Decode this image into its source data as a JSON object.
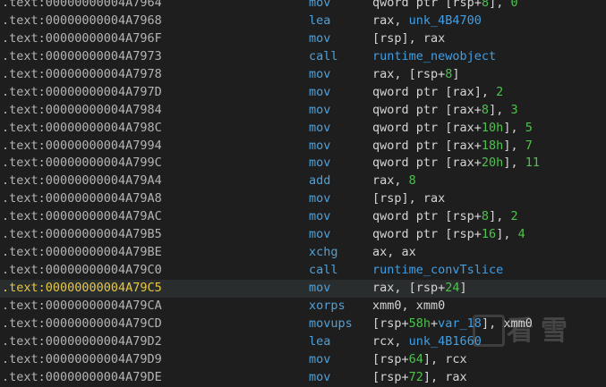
{
  "lines": [
    {
      "addr": ".text:00000000004A7964",
      "mnem": "mov",
      "ops": [
        [
          "qword ptr ",
          "kw"
        ],
        [
          "[",
          "punc"
        ],
        [
          "rsp",
          "reg"
        ],
        [
          "+",
          "punc"
        ],
        [
          "8",
          "num"
        ],
        [
          "], ",
          "punc"
        ],
        [
          "0",
          "num"
        ]
      ]
    },
    {
      "addr": ".text:00000000004A7968",
      "mnem": "lea",
      "ops": [
        [
          "rax, ",
          "reg"
        ],
        [
          "unk_4B4700",
          "sym"
        ]
      ]
    },
    {
      "addr": ".text:00000000004A796F",
      "mnem": "mov",
      "ops": [
        [
          "[rsp], rax",
          "reg"
        ]
      ]
    },
    {
      "addr": ".text:00000000004A7973",
      "mnem": "call",
      "ops": [
        [
          "runtime_newobject",
          "sym"
        ]
      ]
    },
    {
      "addr": ".text:00000000004A7978",
      "mnem": "mov",
      "ops": [
        [
          "rax, [rsp+",
          "reg"
        ],
        [
          "8",
          "num"
        ],
        [
          "]",
          "punc"
        ]
      ]
    },
    {
      "addr": ".text:00000000004A797D",
      "mnem": "mov",
      "ops": [
        [
          "qword ptr [rax], ",
          "reg"
        ],
        [
          "2",
          "num"
        ]
      ]
    },
    {
      "addr": ".text:00000000004A7984",
      "mnem": "mov",
      "ops": [
        [
          "qword ptr [rax+",
          "reg"
        ],
        [
          "8",
          "num"
        ],
        [
          "], ",
          "punc"
        ],
        [
          "3",
          "num"
        ]
      ]
    },
    {
      "addr": ".text:00000000004A798C",
      "mnem": "mov",
      "ops": [
        [
          "qword ptr [rax+",
          "reg"
        ],
        [
          "10h",
          "num"
        ],
        [
          "], ",
          "punc"
        ],
        [
          "5",
          "num"
        ]
      ]
    },
    {
      "addr": ".text:00000000004A7994",
      "mnem": "mov",
      "ops": [
        [
          "qword ptr [rax+",
          "reg"
        ],
        [
          "18h",
          "num"
        ],
        [
          "], ",
          "punc"
        ],
        [
          "7",
          "num"
        ]
      ]
    },
    {
      "addr": ".text:00000000004A799C",
      "mnem": "mov",
      "ops": [
        [
          "qword ptr [rax+",
          "reg"
        ],
        [
          "20h",
          "num"
        ],
        [
          "], ",
          "punc"
        ],
        [
          "11",
          "num"
        ]
      ]
    },
    {
      "addr": ".text:00000000004A79A4",
      "mnem": "add",
      "ops": [
        [
          "rax, ",
          "reg"
        ],
        [
          "8",
          "num"
        ]
      ]
    },
    {
      "addr": ".text:00000000004A79A8",
      "mnem": "mov",
      "ops": [
        [
          "[rsp], rax",
          "reg"
        ]
      ]
    },
    {
      "addr": ".text:00000000004A79AC",
      "mnem": "mov",
      "ops": [
        [
          "qword ptr [rsp+",
          "reg"
        ],
        [
          "8",
          "num"
        ],
        [
          "], ",
          "punc"
        ],
        [
          "2",
          "num"
        ]
      ]
    },
    {
      "addr": ".text:00000000004A79B5",
      "mnem": "mov",
      "ops": [
        [
          "qword ptr [rsp+",
          "reg"
        ],
        [
          "16",
          "num"
        ],
        [
          "], ",
          "punc"
        ],
        [
          "4",
          "num"
        ]
      ]
    },
    {
      "addr": ".text:00000000004A79BE",
      "mnem": "xchg",
      "ops": [
        [
          "ax, ax",
          "reg"
        ]
      ]
    },
    {
      "addr": ".text:00000000004A79C0",
      "mnem": "call",
      "ops": [
        [
          "runtime_convTslice",
          "sym"
        ]
      ]
    },
    {
      "addr": ".text:00000000004A79C5",
      "mnem": "mov",
      "current": true,
      "ops": [
        [
          "rax, [rsp+",
          "reg"
        ],
        [
          "24",
          "num"
        ],
        [
          "]",
          "punc"
        ]
      ]
    },
    {
      "addr": ".text:00000000004A79CA",
      "mnem": "xorps",
      "ops": [
        [
          "xmm0, xmm0",
          "reg"
        ]
      ]
    },
    {
      "addr": ".text:00000000004A79CD",
      "mnem": "movups",
      "ops": [
        [
          "[rsp+",
          "reg"
        ],
        [
          "58h",
          "num"
        ],
        [
          "+",
          "punc"
        ],
        [
          "var_18",
          "sym"
        ],
        [
          "], xmm0",
          "reg"
        ]
      ]
    },
    {
      "addr": ".text:00000000004A79D2",
      "mnem": "lea",
      "ops": [
        [
          "rcx, ",
          "reg"
        ],
        [
          "unk_4B1660",
          "sym"
        ]
      ]
    },
    {
      "addr": ".text:00000000004A79D9",
      "mnem": "mov",
      "ops": [
        [
          "[rsp+",
          "reg"
        ],
        [
          "64",
          "num"
        ],
        [
          "], rcx",
          "reg"
        ]
      ]
    },
    {
      "addr": ".text:00000000004A79DE",
      "mnem": "mov",
      "ops": [
        [
          "[rsp+",
          "reg"
        ],
        [
          "72",
          "num"
        ],
        [
          "], rax",
          "reg"
        ]
      ]
    }
  ],
  "watermark": "看雪"
}
